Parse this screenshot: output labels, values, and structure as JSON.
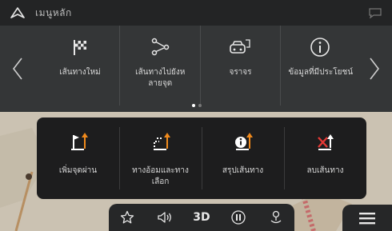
{
  "header": {
    "title": "เมนูหลัก",
    "logo_icon": "navigation-arrow-icon",
    "right_icon": "speech-bubble-icon"
  },
  "main_menu": {
    "items": [
      {
        "label": "เส้นทางใหม่",
        "icon": "checkered-flag-icon"
      },
      {
        "label": "เส้นทางไปยังหลายจุด",
        "label_line1": "เส้นทางไปยังห",
        "label_line2": "ลายจุด",
        "icon": "multi-stop-route-icon"
      },
      {
        "label": "จราจร",
        "icon": "traffic-car-icon"
      },
      {
        "label": "ข้อมูลที่มีประโยชน์",
        "icon": "info-icon"
      }
    ],
    "page_indicator": {
      "current": 1,
      "total": 2
    }
  },
  "route_menu": {
    "items": [
      {
        "label": "เพิ่มจุดผ่าน",
        "icon": "add-waypoint-icon"
      },
      {
        "label_line1": "ทางอ้อมและทาง",
        "label_line2": "เลือก",
        "icon": "detour-icon"
      },
      {
        "label": "สรุปเส้นทาง",
        "icon": "route-summary-icon"
      },
      {
        "label": "ลบเส้นทาง",
        "icon": "delete-route-icon"
      }
    ]
  },
  "toolbar": {
    "buttons": [
      {
        "icon": "star-icon",
        "glyph": "☆"
      },
      {
        "icon": "volume-icon",
        "glyph": "◁)"
      },
      {
        "icon": "3d-view-icon",
        "text": "3D"
      },
      {
        "icon": "pause-icon",
        "glyph": "⏸"
      },
      {
        "icon": "location-pin-icon",
        "glyph": "⚲"
      }
    ],
    "menu_icon": "hamburger-menu-icon"
  },
  "colors": {
    "accent_orange": "#f08a1c",
    "delete_red": "#e53935",
    "panel_dark": "#1d1d1e",
    "menu_bg": "#343637"
  }
}
